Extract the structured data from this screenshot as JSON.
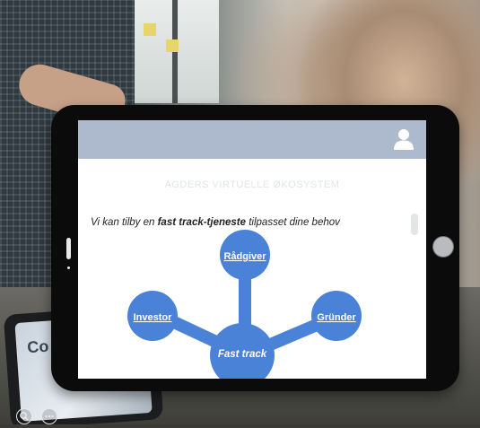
{
  "app": {
    "heading": "AGDERS VIRTUELLE ØKOSYSTEM",
    "intro": {
      "prefix": "Vi kan tilby en ",
      "emphasis": "fast track-tjeneste",
      "suffix": " tilpasset dine behov"
    }
  },
  "diagram": {
    "center": "Fast track",
    "nodes": {
      "top": "Rådgiver",
      "left": "Investor",
      "right": "Gründer"
    },
    "color": "#4a82d8"
  },
  "colors": {
    "topbar": "#adb9cc",
    "node": "#4a82d8",
    "heading_text": "#e1e5ea"
  },
  "icons": {
    "user": "user-icon",
    "zoom": "zoom-icon",
    "more": "more-icon"
  }
}
